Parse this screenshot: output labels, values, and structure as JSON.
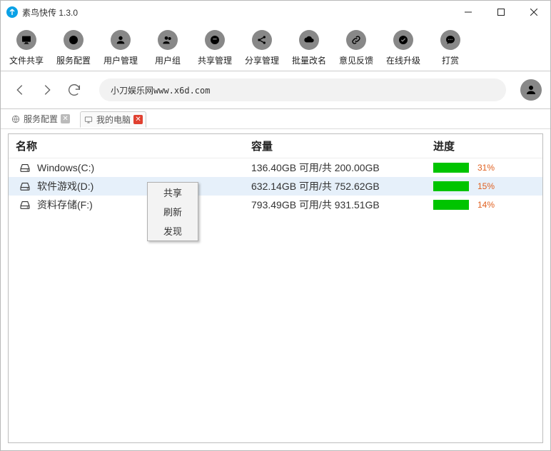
{
  "window": {
    "title": "素鸟快传 1.3.0"
  },
  "toolbar": [
    {
      "name": "file-share",
      "label": "文件共享",
      "icon": "monitor"
    },
    {
      "name": "service-cfg",
      "label": "服务配置",
      "icon": "globe"
    },
    {
      "name": "user-mgmt",
      "label": "用户管理",
      "icon": "user"
    },
    {
      "name": "user-groups",
      "label": "用户组",
      "icon": "users"
    },
    {
      "name": "share-mgmt",
      "label": "共享管理",
      "icon": "folder"
    },
    {
      "name": "share-admin",
      "label": "分享管理",
      "icon": "share"
    },
    {
      "name": "batch-rename",
      "label": "批量改名",
      "icon": "cloud"
    },
    {
      "name": "feedback",
      "label": "意见反馈",
      "icon": "link"
    },
    {
      "name": "update",
      "label": "在线升级",
      "icon": "check"
    },
    {
      "name": "donate",
      "label": "打赏",
      "icon": "chat"
    }
  ],
  "address": "小刀娱乐网www.x6d.com",
  "tabs": [
    {
      "name": "tab-service-cfg",
      "label": "服务配置",
      "icon": "globe",
      "close": "gray",
      "active": false
    },
    {
      "name": "tab-my-computer",
      "label": "我的电脑",
      "icon": "monitor",
      "close": "red",
      "active": true
    }
  ],
  "columns": {
    "name": "名称",
    "capacity": "容量",
    "progress": "进度"
  },
  "drives": [
    {
      "name": "Windows(C:)",
      "capacity": "136.40GB 可用/共 200.00GB",
      "percent": "31%",
      "selected": false
    },
    {
      "name": "软件游戏(D:)",
      "capacity": "632.14GB 可用/共 752.62GB",
      "percent": "15%",
      "selected": true
    },
    {
      "name": "资料存储(F:)",
      "capacity": "793.49GB 可用/共 931.51GB",
      "percent": "14%",
      "selected": false
    }
  ],
  "context_menu": [
    {
      "name": "ctx-share",
      "label": "共享"
    },
    {
      "name": "ctx-refresh",
      "label": "刷新"
    },
    {
      "name": "ctx-discover",
      "label": "发现"
    }
  ]
}
